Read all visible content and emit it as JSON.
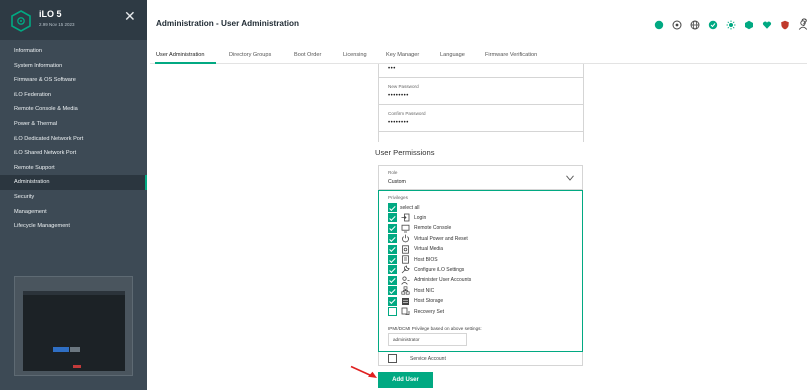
{
  "sidebar": {
    "brand": "iLO 5",
    "version": "2.99 Nov 15 2023",
    "items": [
      {
        "label": "Information"
      },
      {
        "label": "System Information"
      },
      {
        "label": "Firmware & OS Software"
      },
      {
        "label": "iLO Federation"
      },
      {
        "label": "Remote Console & Media"
      },
      {
        "label": "Power & Thermal"
      },
      {
        "label": "iLO Dedicated Network Port"
      },
      {
        "label": "iLO Shared Network Port"
      },
      {
        "label": "Remote Support"
      },
      {
        "label": "Administration"
      },
      {
        "label": "Security"
      },
      {
        "label": "Management"
      },
      {
        "label": "Lifecycle Management"
      }
    ],
    "active_index": 9
  },
  "header": {
    "title": "Administration - User Administration",
    "status_icons": [
      "health-icon",
      "target-icon",
      "globe-icon",
      "check-icon",
      "sun-icon",
      "chip-icon",
      "heart-icon",
      "shield-icon",
      "user-icon"
    ],
    "help": "?"
  },
  "tabs": [
    {
      "label": "User Administration",
      "active": true
    },
    {
      "label": "Directory Groups"
    },
    {
      "label": "Boot Order"
    },
    {
      "label": "Licensing"
    },
    {
      "label": "Key Manager"
    },
    {
      "label": "Language"
    },
    {
      "label": "Firmware Verification"
    }
  ],
  "form": {
    "top_value": "•••",
    "new_password": {
      "label": "New Password",
      "value": "••••••••"
    },
    "confirm_password": {
      "label": "Confirm Password",
      "value": "••••••••"
    },
    "permissions_title": "User Permissions",
    "role": {
      "label": "Role",
      "value": "Custom"
    },
    "privileges_label": "Privileges",
    "privileges": [
      {
        "label": "select all",
        "checked": true,
        "icon": ""
      },
      {
        "label": "Login",
        "checked": true,
        "icon": "login-icon"
      },
      {
        "label": "Remote Console",
        "checked": true,
        "icon": "monitor-icon"
      },
      {
        "label": "Virtual Power and Reset",
        "checked": true,
        "icon": "power-icon"
      },
      {
        "label": "Virtual Media",
        "checked": true,
        "icon": "disc-icon"
      },
      {
        "label": "Host BIOS",
        "checked": true,
        "icon": "bios-icon"
      },
      {
        "label": "Configure iLO Settings",
        "checked": true,
        "icon": "wrench-icon"
      },
      {
        "label": "Administer User Accounts",
        "checked": true,
        "icon": "user-admin-icon"
      },
      {
        "label": "Host NIC",
        "checked": true,
        "icon": "network-icon"
      },
      {
        "label": "Host Storage",
        "checked": true,
        "icon": "storage-icon"
      },
      {
        "label": "Recovery Set",
        "checked": false,
        "icon": "recovery-icon"
      }
    ],
    "ipmi_label": "IPMI/DCMI Privilege based on above settings:",
    "ipmi_value": "administrator",
    "service_account": {
      "label": "Service Account",
      "checked": false
    },
    "add_user_label": "Add User"
  },
  "colors": {
    "accent": "#01a982",
    "sidebar_bg": "#3d4a55",
    "sidebar_header_bg": "#2e3a44",
    "arrow": "#e02020"
  }
}
